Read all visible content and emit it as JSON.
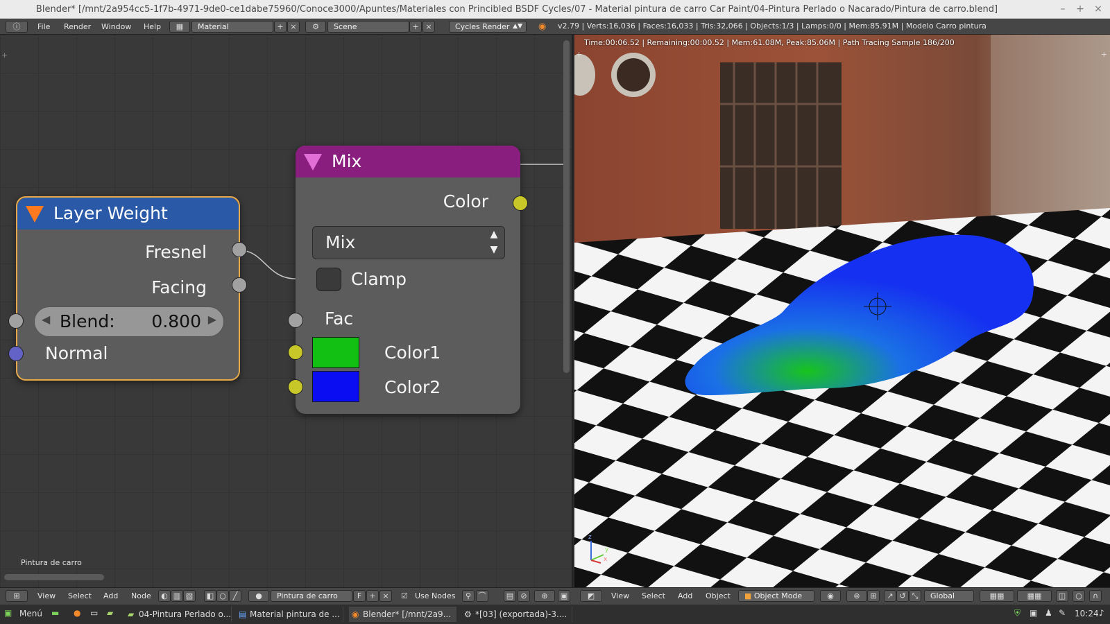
{
  "window": {
    "title": "Blender* [/mnt/2a954cc5-1f7b-4971-9de0-ce1dabe75960/Conoce3000/Apuntes/Materiales con Princibled BSDF Cycles/07 - Material pintura de carro Car Paint/04-Pintura Perlado o Nacarado/Pintura de carro.blend]"
  },
  "info_header": {
    "menus": [
      "File",
      "Render",
      "Window",
      "Help"
    ],
    "screen_layout": "Material",
    "scene": "Scene",
    "render_engine": "Cycles Render",
    "stats": "v2.79 | Verts:16,036 | Faces:16,033 | Tris:32,066 | Objects:1/3 | Lamps:0/0 | Mem:85.91M | Modelo Carro pintura"
  },
  "node_editor": {
    "nodes": {
      "layer_weight": {
        "title": "Layer Weight",
        "outputs": [
          "Fresnel",
          "Facing"
        ],
        "blend_label": "Blend:",
        "blend_value": "0.800",
        "inputs": [
          "Normal"
        ]
      },
      "mix": {
        "title": "Mix",
        "output": "Color",
        "blend_type": "Mix",
        "clamp_label": "Clamp",
        "fac_label": "Fac",
        "color1_label": "Color1",
        "color2_label": "Color2",
        "color1": "#12c013",
        "color2": "#0a0cf2"
      }
    },
    "material_name": "Pintura de carro",
    "header": {
      "menus": [
        "View",
        "Select",
        "Add",
        "Node"
      ],
      "material_field": "Pintura de carro",
      "fake_user": "F",
      "use_nodes_label": "Use Nodes"
    }
  },
  "viewport": {
    "render_status": "Time:00:06.52 | Remaining:00:00.52 | Mem:61.08M, Peak:85.06M | Path Tracing Sample 186/200",
    "header": {
      "menus": [
        "View",
        "Select",
        "Add",
        "Object"
      ],
      "mode": "Object Mode",
      "orientation": "Global"
    },
    "axis": {
      "z": "z",
      "y": "y",
      "x": "x"
    }
  },
  "taskbar": {
    "menu_label": "Menú",
    "tasks": [
      "04-Pintura Perlado o...",
      "Material pintura de ...",
      "Blender* [/mnt/2a9...",
      "*[03] (exportada)-3...."
    ],
    "clock": "10:24"
  }
}
